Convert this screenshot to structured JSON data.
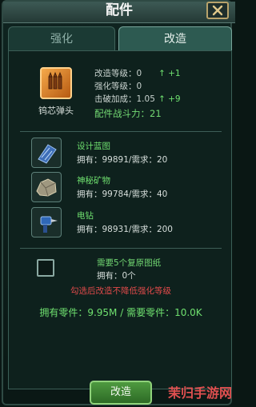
{
  "window": {
    "title": "配件"
  },
  "tabs": {
    "strengthen": "强化",
    "modify": "改造"
  },
  "item": {
    "name": "钨芯弹头",
    "stats": [
      {
        "label": "改造等级：0",
        "gain": "↑ +1"
      },
      {
        "label": "强化等级：0",
        "gain": ""
      },
      {
        "label": "击破加成：1.05",
        "gain": "↑ +9"
      }
    ],
    "power": "配件战斗力：21"
  },
  "materials": [
    {
      "name": "设计蓝图",
      "count": "拥有：99891/需求：20",
      "icon": "blueprint-icon"
    },
    {
      "name": "神秘矿物",
      "count": "拥有：99784/需求：40",
      "icon": "ore-icon"
    },
    {
      "name": "电钻",
      "count": "拥有：98931/需求：200",
      "icon": "drill-icon"
    }
  ],
  "blueprint_option": {
    "need": "需要5个复原图纸",
    "have": "拥有：0个",
    "warning": "勾选后改造不降低强化等级"
  },
  "parts": "拥有零件：9.95M / 需要零件：10.0K",
  "buttons": {
    "modify": "改造"
  },
  "watermark": "茉归手游网",
  "colors": {
    "accent_green": "#6fe06f",
    "warning_red": "#e04a4a",
    "panel_bg": "#0e211d",
    "button_green": "#4e9a40"
  }
}
